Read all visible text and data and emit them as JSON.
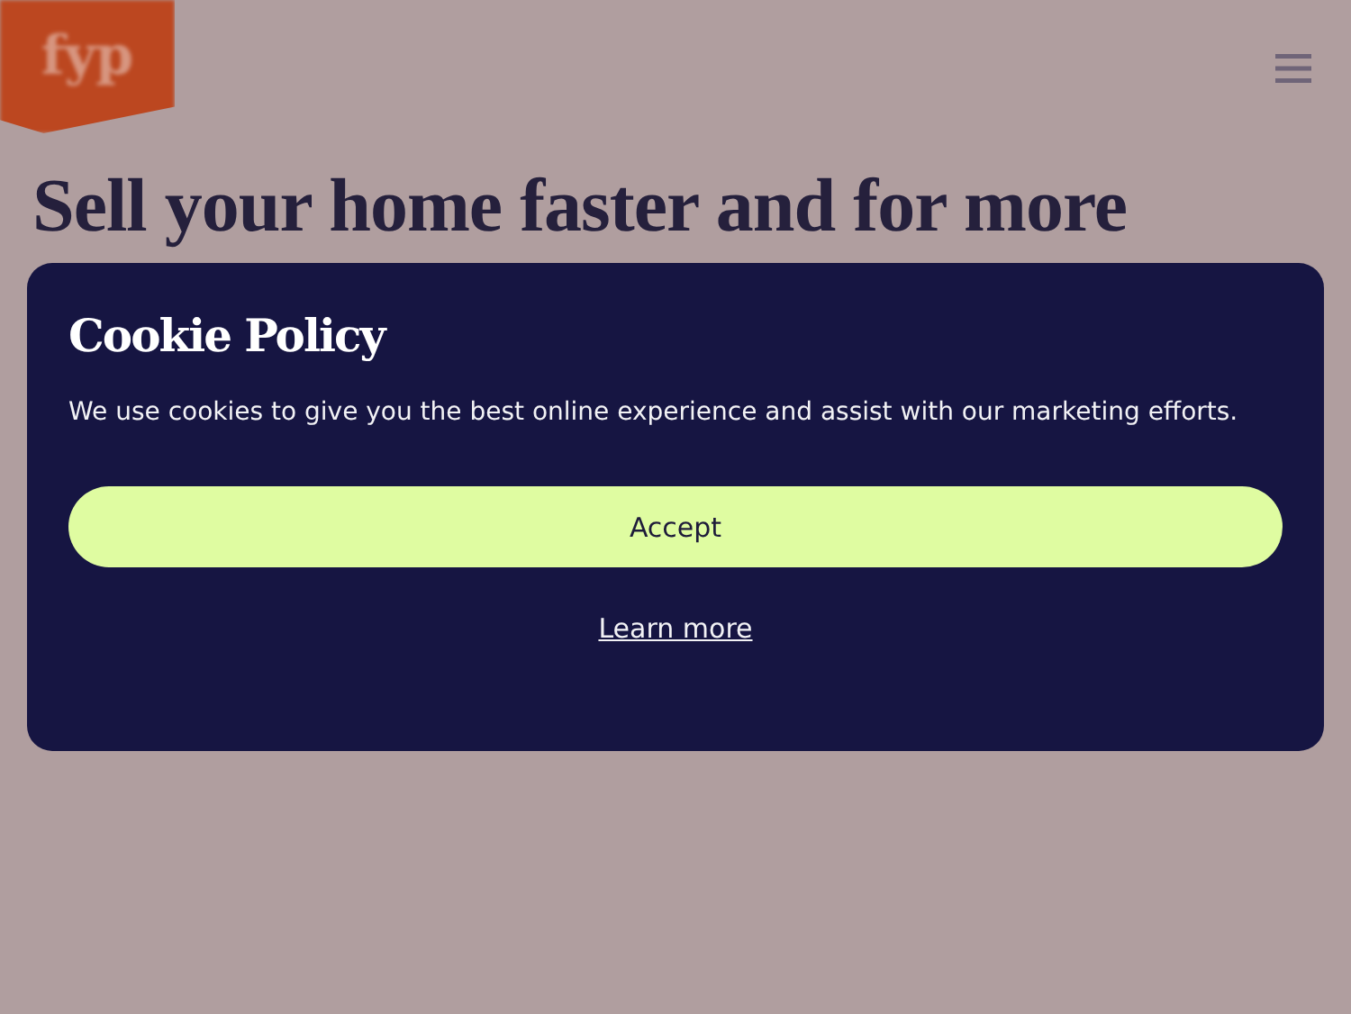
{
  "header": {
    "logo": "fyp"
  },
  "hero": {
    "headline": "Sell your home faster and for more"
  },
  "cookie_dialog": {
    "title": "Cookie Policy",
    "message": "We use cookies to give you the best online experience and assist with our marketing efforts.",
    "accept_button": "Accept",
    "learn_more_link": "Learn more"
  }
}
